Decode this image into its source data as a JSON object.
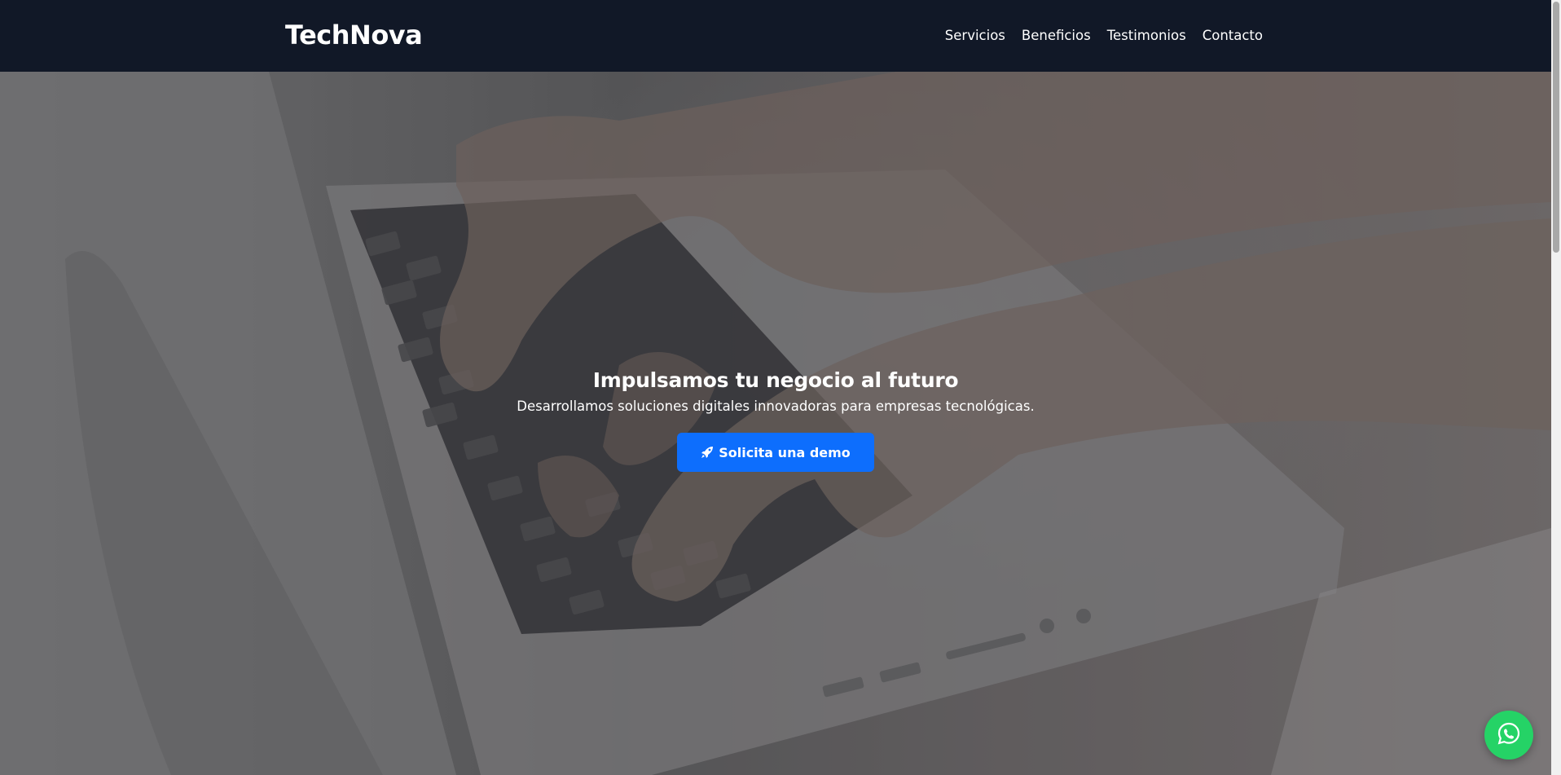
{
  "header": {
    "logo": "TechNova",
    "nav": [
      "Servicios",
      "Beneficios",
      "Testimonios",
      "Contacto"
    ]
  },
  "hero": {
    "title": "Impulsamos tu negocio al futuro",
    "subtitle": "Desarrollamos soluciones digitales innovadoras para empresas tecnológicas.",
    "cta_label": "Solicita una demo",
    "cta_icon": "rocket-icon",
    "background_image": "hands-typing-on-laptop-keyboard-photo"
  },
  "floating": {
    "icon": "whatsapp-icon"
  },
  "colors": {
    "header_bg": "#111827",
    "cta_bg": "#0d6efd",
    "whatsapp_bg": "#25d366"
  }
}
